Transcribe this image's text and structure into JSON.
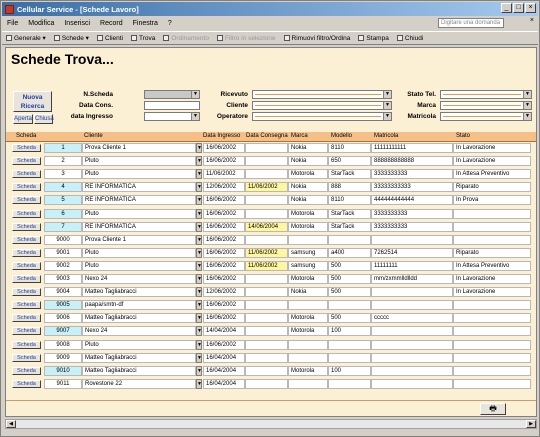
{
  "window": {
    "title": "Cellular Service - [Schede Lavoro]",
    "btn_min": "_",
    "btn_max": "□",
    "btn_close": "×"
  },
  "menu": {
    "items": [
      "File",
      "Modifica",
      "Inserisci",
      "Record",
      "Finestra",
      "?"
    ],
    "help_placeholder": "Digitare una domanda",
    "close": "×"
  },
  "toolbar": {
    "items": [
      {
        "label": "Generale ▾",
        "disabled": false
      },
      {
        "label": "Schede ▾",
        "disabled": false
      },
      {
        "label": "Clienti",
        "disabled": false
      },
      {
        "label": "Trova",
        "disabled": false
      },
      {
        "label": "Ordinamento",
        "disabled": true
      },
      {
        "label": "Filtro in selezione",
        "disabled": true
      },
      {
        "label": "Rimuovi filtro/Ordina",
        "disabled": false
      },
      {
        "label": "Stampa",
        "disabled": false
      },
      {
        "label": "Chiudi",
        "disabled": false
      }
    ]
  },
  "page": {
    "title": "Schede Trova..."
  },
  "actions": {
    "nuova_ricerca": "Nuova Ricerca",
    "aperta": "Aperta",
    "chiusa": "Chiusa"
  },
  "filters": {
    "n_scheda": "N.Scheda",
    "data_cons": "Data Cons.",
    "data_ingresso": "data Ingresso",
    "ricevuto": "Ricevuto",
    "cliente": "Cliente",
    "operatore": "Operatore",
    "stato_tel": "Stato Tel.",
    "marca": "Marca",
    "matricola": "Matricola"
  },
  "grid": {
    "headers": [
      "Scheda",
      "Cliente",
      "Data Ingresso",
      "Data Consegna",
      "Marca",
      "Modello",
      "Matricola",
      "Stato"
    ],
    "scheda_button": "Scheda",
    "rows": [
      {
        "id": "1",
        "hl": true,
        "cliente": "Prova Cliente 1",
        "ingresso": "16/06/2002",
        "consegna": "",
        "marca": "Nokia",
        "modello": "8110",
        "matricola": "11111111111",
        "stato": "In Lavorazione"
      },
      {
        "id": "2",
        "hl": false,
        "cliente": "Pluto",
        "ingresso": "16/06/2002",
        "consegna": "",
        "marca": "Nokia",
        "modello": "650",
        "matricola": "888888888888",
        "stato": "In Lavorazione"
      },
      {
        "id": "3",
        "hl": false,
        "cliente": "Pluto",
        "ingresso": "11/06/2002",
        "consegna": "",
        "marca": "Motorola",
        "modello": "StarTack",
        "matricola": "3333333333",
        "stato": "In Attesa Preventivo"
      },
      {
        "id": "4",
        "hl": true,
        "cliente": "RE INFORMATICA",
        "ingresso": "12/06/2002",
        "consegna": "11/06/2002",
        "marca": "Nokia",
        "modello": "888",
        "matricola": "33333333333",
        "stato": "Riparato"
      },
      {
        "id": "5",
        "hl": true,
        "cliente": "RE INFORMATICA",
        "ingresso": "16/06/2002",
        "consegna": "",
        "marca": "Nokia",
        "modello": "8110",
        "matricola": "444444444444",
        "stato": "In Prova"
      },
      {
        "id": "6",
        "hl": true,
        "cliente": "Pluto",
        "ingresso": "16/06/2002",
        "consegna": "",
        "marca": "Motorola",
        "modello": "StarTack",
        "matricola": "3333333333",
        "stato": ""
      },
      {
        "id": "7",
        "hl": true,
        "cliente": "RE INFORMATICA",
        "ingresso": "16/06/2002",
        "consegna": "14/06/2004",
        "marca": "Motorola",
        "modello": "StarTack",
        "matricola": "3333333333",
        "stato": ""
      },
      {
        "id": "9000",
        "hl": false,
        "cliente": "Prova Cliente 1",
        "ingresso": "16/06/2002",
        "consegna": "",
        "marca": "",
        "modello": "",
        "matricola": "",
        "stato": ""
      },
      {
        "id": "9001",
        "hl": false,
        "cliente": "Pluto",
        "ingresso": "16/06/2002",
        "consegna": "11/06/2002",
        "marca": "samsung",
        "modello": "a400",
        "matricola": "7262514",
        "stato": "Riparato"
      },
      {
        "id": "9002",
        "hl": false,
        "cliente": "Pluto",
        "ingresso": "16/06/2002",
        "consegna": "11/06/2002",
        "marca": "samsung",
        "modello": "500",
        "matricola": "11111111",
        "stato": "In Attesa Preventivo"
      },
      {
        "id": "9003",
        "hl": false,
        "cliente": "Nexo 24",
        "ingresso": "16/06/2002",
        "consegna": "",
        "marca": "Motorola",
        "modello": "500",
        "matricola": "mm/zxmmlldlldd",
        "stato": "In Lavorazione"
      },
      {
        "id": "9004",
        "hl": false,
        "cliente": "Matteo Tagliabracci",
        "ingresso": "12/06/2002",
        "consegna": "",
        "marca": "Nokia",
        "modello": "500",
        "matricola": "",
        "stato": "In Lavorazione"
      },
      {
        "id": "9005",
        "hl": true,
        "cliente": "paapa/smtn-df",
        "ingresso": "16/06/2002",
        "consegna": "",
        "marca": "",
        "modello": "",
        "matricola": "",
        "stato": ""
      },
      {
        "id": "9006",
        "hl": false,
        "cliente": "Matteo Tagliabracci",
        "ingresso": "16/06/2002",
        "consegna": "",
        "marca": "Motorola",
        "modello": "500",
        "matricola": "ccccc",
        "stato": ""
      },
      {
        "id": "9007",
        "hl": true,
        "cliente": "Nexo 24",
        "ingresso": "14/04/2004",
        "consegna": "",
        "marca": "Motorola",
        "modello": "100",
        "matricola": "",
        "stato": ""
      },
      {
        "id": "9008",
        "hl": false,
        "cliente": "Pluto",
        "ingresso": "16/06/2002",
        "consegna": "",
        "marca": "",
        "modello": "",
        "matricola": "",
        "stato": ""
      },
      {
        "id": "9009",
        "hl": false,
        "cliente": "Matteo Tagliabracci",
        "ingresso": "16/04/2004",
        "consegna": "",
        "marca": "",
        "modello": "",
        "matricola": "",
        "stato": ""
      },
      {
        "id": "9010",
        "hl": true,
        "cliente": "Matteo Tagliabracci",
        "ingresso": "16/04/2004",
        "consegna": "",
        "marca": "Motorola",
        "modello": "100",
        "matricola": "",
        "stato": ""
      },
      {
        "id": "9011",
        "hl": false,
        "cliente": "Rovestone 22",
        "ingresso": "16/04/2004",
        "consegna": "",
        "marca": "",
        "modello": "",
        "matricola": "",
        "stato": ""
      }
    ]
  },
  "footer": {
    "print_label": "🖶"
  },
  "colors": {
    "form_bg": "#fbf0d4",
    "header_bg": "#f5c088",
    "highlight_id": "#c8f0f8",
    "highlight_date": "#fff7a0",
    "title_blue": "#3a6ea5"
  }
}
